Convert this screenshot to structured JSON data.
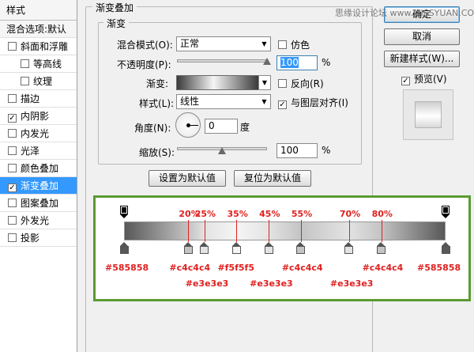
{
  "left_panel": {
    "header": "样式",
    "items": [
      {
        "label": "混合选项:默认",
        "checkbox": false,
        "indent": false,
        "selected": false,
        "blend": true
      },
      {
        "label": "斜面和浮雕",
        "checkbox": true,
        "checked": false,
        "indent": false,
        "selected": false
      },
      {
        "label": "等高线",
        "checkbox": true,
        "checked": false,
        "indent": true,
        "selected": false
      },
      {
        "label": "纹理",
        "checkbox": true,
        "checked": false,
        "indent": true,
        "selected": false
      },
      {
        "label": "描边",
        "checkbox": true,
        "checked": false,
        "indent": false,
        "selected": false
      },
      {
        "label": "内阴影",
        "checkbox": true,
        "checked": true,
        "indent": false,
        "selected": false
      },
      {
        "label": "内发光",
        "checkbox": true,
        "checked": false,
        "indent": false,
        "selected": false
      },
      {
        "label": "光泽",
        "checkbox": true,
        "checked": false,
        "indent": false,
        "selected": false
      },
      {
        "label": "颜色叠加",
        "checkbox": true,
        "checked": false,
        "indent": false,
        "selected": false
      },
      {
        "label": "渐变叠加",
        "checkbox": true,
        "checked": true,
        "indent": false,
        "selected": true
      },
      {
        "label": "图案叠加",
        "checkbox": true,
        "checked": false,
        "indent": false,
        "selected": false
      },
      {
        "label": "外发光",
        "checkbox": true,
        "checked": false,
        "indent": false,
        "selected": false
      },
      {
        "label": "投影",
        "checkbox": true,
        "checked": false,
        "indent": false,
        "selected": false
      }
    ]
  },
  "gradient_overlay": {
    "section_title": "渐变叠加",
    "group_title": "渐变",
    "blend_mode_label": "混合模式(O):",
    "blend_mode_value": "正常",
    "dither_label": "仿色",
    "opacity_label": "不透明度(P):",
    "opacity_value": "100",
    "opacity_unit": "%",
    "opacity_level": 1.0,
    "gradient_label": "渐变:",
    "reverse_label": "反向(R)",
    "style_label": "样式(L):",
    "style_value": "线性",
    "align_label": "与图层对齐(I)",
    "angle_label": "角度(N):",
    "angle_value": "0",
    "angle_unit": "度",
    "scale_label": "缩放(S):",
    "scale_value": "100",
    "scale_unit": "%",
    "scale_level": 0.5,
    "set_default_button": "设置为默认值",
    "reset_default_button": "复位为默认值"
  },
  "right_panel": {
    "ok_button": "确定",
    "cancel_button": "取消",
    "new_style_button": "新建样式(W)...",
    "preview_label": "预览(V)",
    "preview_checked": true,
    "watermark": "思缘设计论坛 www.MISSYUAN.COM"
  },
  "gradient_editor": {
    "percent_labels": [
      "20%",
      "25%",
      "35%",
      "45%",
      "55%",
      "70%",
      "80%"
    ],
    "stops": [
      {
        "pos": 0,
        "color": "#585858"
      },
      {
        "pos": 20,
        "color": "#c4c4c4"
      },
      {
        "pos": 25,
        "color": "#e3e3e3"
      },
      {
        "pos": 35,
        "color": "#f5f5f5"
      },
      {
        "pos": 45,
        "color": "#e3e3e3"
      },
      {
        "pos": 55,
        "color": "#c4c4c4"
      },
      {
        "pos": 70,
        "color": "#e3e3e3"
      },
      {
        "pos": 80,
        "color": "#c4c4c4"
      },
      {
        "pos": 100,
        "color": "#585858"
      }
    ],
    "hex_labels": {
      "s0": "#585858",
      "s20": "#c4c4c4",
      "s25": "#e3e3e3",
      "s35": "#f5f5f5",
      "s45": "#e3e3e3",
      "s55": "#c4c4c4",
      "s70": "#e3e3e3",
      "s80": "#c4c4c4",
      "s100": "#585858"
    }
  }
}
